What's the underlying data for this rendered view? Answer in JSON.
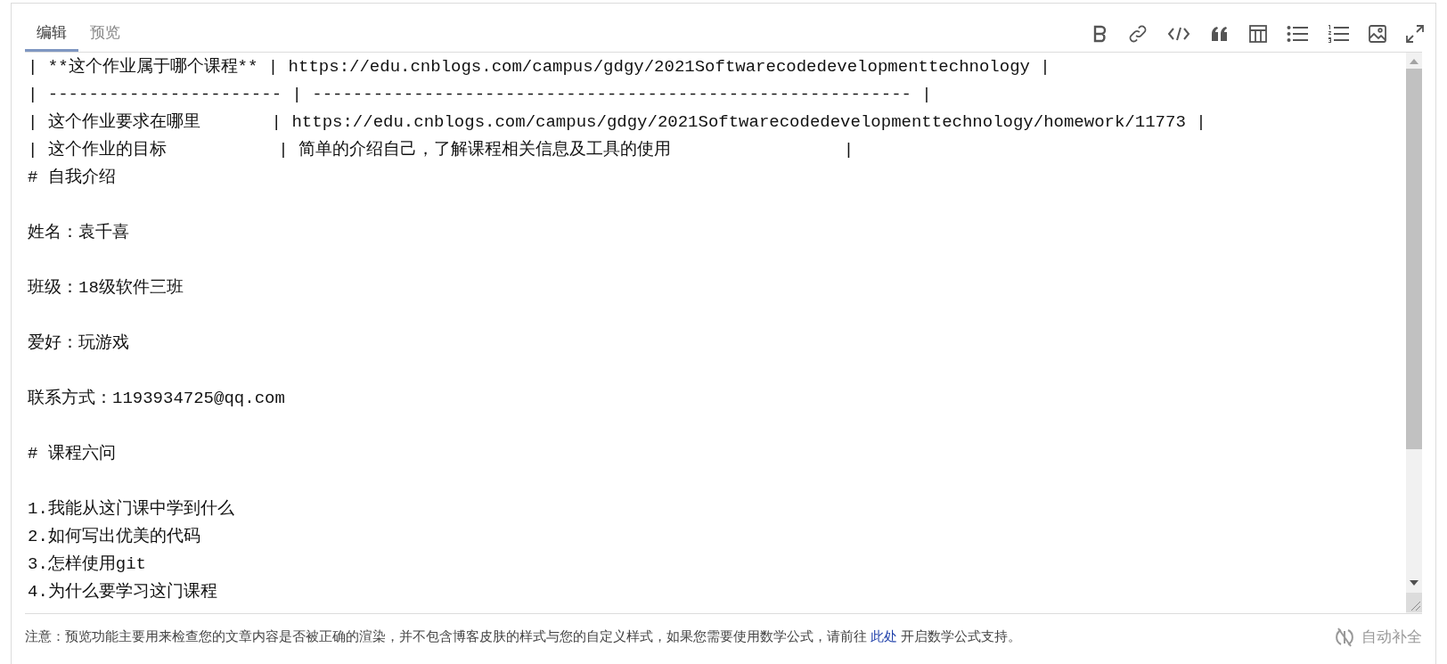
{
  "tabs": [
    {
      "label": "编辑",
      "selected": true
    },
    {
      "label": "预览",
      "selected": false
    }
  ],
  "editor": {
    "paragraphs": [
      [
        "| **这个作业属于哪个课程** | https://edu.cnblogs.com/campus/gdgy/2021Softwarecodedevelopmenttechnology |",
        "| ----------------------- | ----------------------------------------------------------- |",
        "| 这个作业要求在哪里       | https://edu.cnblogs.com/campus/gdgy/2021Softwarecodedevelopmenttechnology/homework/11773 |",
        "| 这个作业的目标           | 简单的介绍自己，了解课程相关信息及工具的使用                 |",
        "# 自我介绍"
      ],
      [
        "姓名：袁千喜"
      ],
      [
        "班级：18级软件三班"
      ],
      [
        "爱好：玩游戏"
      ],
      [
        "联系方式：1193934725@qq.com"
      ],
      [
        "# 课程六问"
      ],
      [
        "1.我能从这门课中学到什么",
        "2.如何写出优美的代码",
        "3.怎样使用git",
        "4.为什么要学习这门课程"
      ]
    ]
  },
  "footer": {
    "note_before": "注意：预览功能主要用来检查您的文章内容是否被正确的渲染，并不包含博客皮肤的样式与您的自定义样式，如果您需要使用数学公式，请前往",
    "link": "此处",
    "note_after": "开启数学公式支持。",
    "autocomplete": "自动补全"
  }
}
